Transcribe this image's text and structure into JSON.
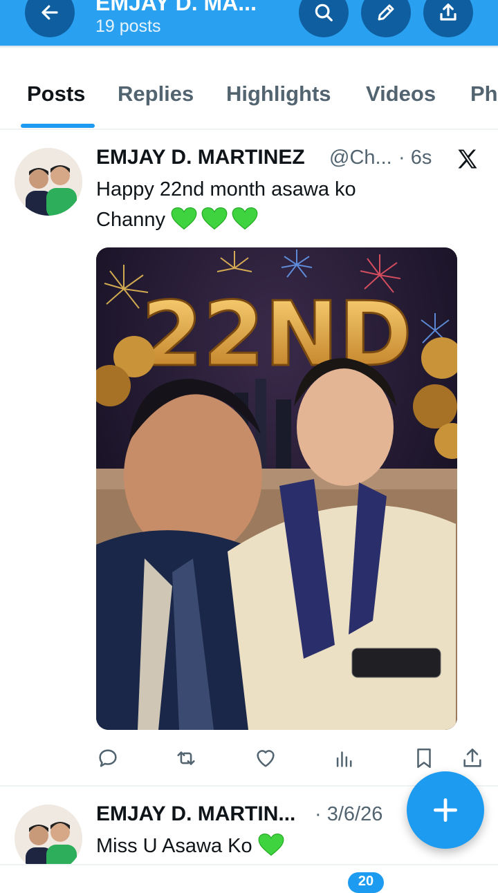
{
  "header": {
    "title": "EMJAY D. MA...",
    "posts_count": "19 posts",
    "back_icon": "arrow-left-icon",
    "search_icon": "search-icon",
    "edit_icon": "pencil-icon",
    "share_icon": "share-icon",
    "color": "#2aa1f0"
  },
  "tabs": [
    {
      "label": "Posts",
      "active": true
    },
    {
      "label": "Replies"
    },
    {
      "label": "Highlights"
    },
    {
      "label": "Videos"
    },
    {
      "label": "Ph"
    }
  ],
  "posts": [
    {
      "name": "EMJAY D. MARTINEZ",
      "handle": "@Ch...",
      "time": "· 6s",
      "text_line1": "Happy 22nd month asawa ko",
      "text_line2": "Channy",
      "emoji": "green-heart",
      "hearts": 3,
      "media_text": "22ND"
    },
    {
      "name": "EMJAY D. MARTIN...",
      "time": "· 3/6/26",
      "text": "Miss U Asawa Ko",
      "emoji": "green-heart"
    }
  ],
  "actions": [
    "reply-icon",
    "retweet-icon",
    "like-icon",
    "views-icon",
    "bookmark-icon",
    "share-icon"
  ],
  "fab": {
    "icon": "plus-icon",
    "color": "#1d9bf0"
  },
  "bottom_badge": "20"
}
